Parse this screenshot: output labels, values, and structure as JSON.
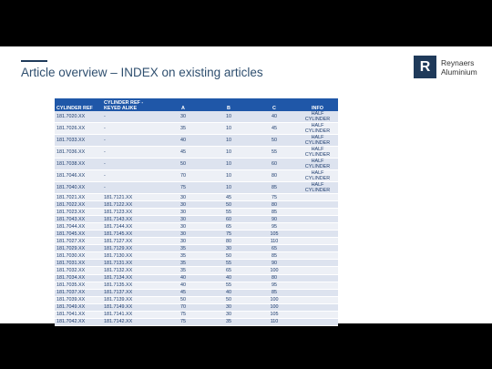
{
  "title": "Article overview – INDEX on existing articles",
  "logo": {
    "mark": "R",
    "line1": "Reynaers",
    "line2": "Aluminium"
  },
  "table": {
    "headers": [
      "CYLINDER REF",
      "CYLINDER REF - KEYED ALIKE",
      "A",
      "B",
      "C",
      "INFO"
    ],
    "rows": [
      [
        "181.7020.XX",
        "-",
        "30",
        "10",
        "40",
        "HALF CYLINDER"
      ],
      [
        "181.7026.XX",
        "-",
        "35",
        "10",
        "45",
        "HALF CYLINDER"
      ],
      [
        "181.7033.XX",
        "-",
        "40",
        "10",
        "50",
        "HALF CYLINDER"
      ],
      [
        "181.7036.XX",
        "-",
        "45",
        "10",
        "55",
        "HALF CYLINDER"
      ],
      [
        "181.7038.XX",
        "-",
        "50",
        "10",
        "60",
        "HALF CYLINDER"
      ],
      [
        "181.7046.XX",
        "-",
        "70",
        "10",
        "80",
        "HALF CYLINDER"
      ],
      [
        "181.7040.XX",
        "-",
        "75",
        "10",
        "85",
        "HALF CYLINDER"
      ],
      [
        "181.7021.XX",
        "181.7121.XX",
        "30",
        "45",
        "75",
        ""
      ],
      [
        "181.7022.XX",
        "181.7122.XX",
        "30",
        "50",
        "80",
        ""
      ],
      [
        "181.7023.XX",
        "181.7123.XX",
        "30",
        "55",
        "85",
        ""
      ],
      [
        "181.7043.XX",
        "181.7143.XX",
        "30",
        "60",
        "90",
        ""
      ],
      [
        "181.7044.XX",
        "181.7144.XX",
        "30",
        "65",
        "95",
        ""
      ],
      [
        "181.7045.XX",
        "181.7145.XX",
        "30",
        "75",
        "105",
        ""
      ],
      [
        "181.7027.XX",
        "181.7127.XX",
        "30",
        "80",
        "110",
        ""
      ],
      [
        "181.7029.XX",
        "181.7129.XX",
        "35",
        "30",
        "65",
        ""
      ],
      [
        "181.7030.XX",
        "181.7130.XX",
        "35",
        "50",
        "85",
        ""
      ],
      [
        "181.7031.XX",
        "181.7131.XX",
        "35",
        "55",
        "90",
        ""
      ],
      [
        "181.7032.XX",
        "181.7132.XX",
        "35",
        "65",
        "100",
        ""
      ],
      [
        "181.7034.XX",
        "181.7134.XX",
        "40",
        "40",
        "80",
        ""
      ],
      [
        "181.7035.XX",
        "181.7135.XX",
        "40",
        "55",
        "95",
        ""
      ],
      [
        "181.7037.XX",
        "181.7137.XX",
        "45",
        "40",
        "85",
        ""
      ],
      [
        "181.7039.XX",
        "181.7139.XX",
        "50",
        "50",
        "100",
        ""
      ],
      [
        "181.7049.XX",
        "181.7149.XX",
        "70",
        "30",
        "100",
        ""
      ],
      [
        "181.7041.XX",
        "181.7141.XX",
        "75",
        "30",
        "105",
        ""
      ],
      [
        "181.7042.XX",
        "181.7142.XX",
        "75",
        "35",
        "110",
        ""
      ]
    ]
  }
}
